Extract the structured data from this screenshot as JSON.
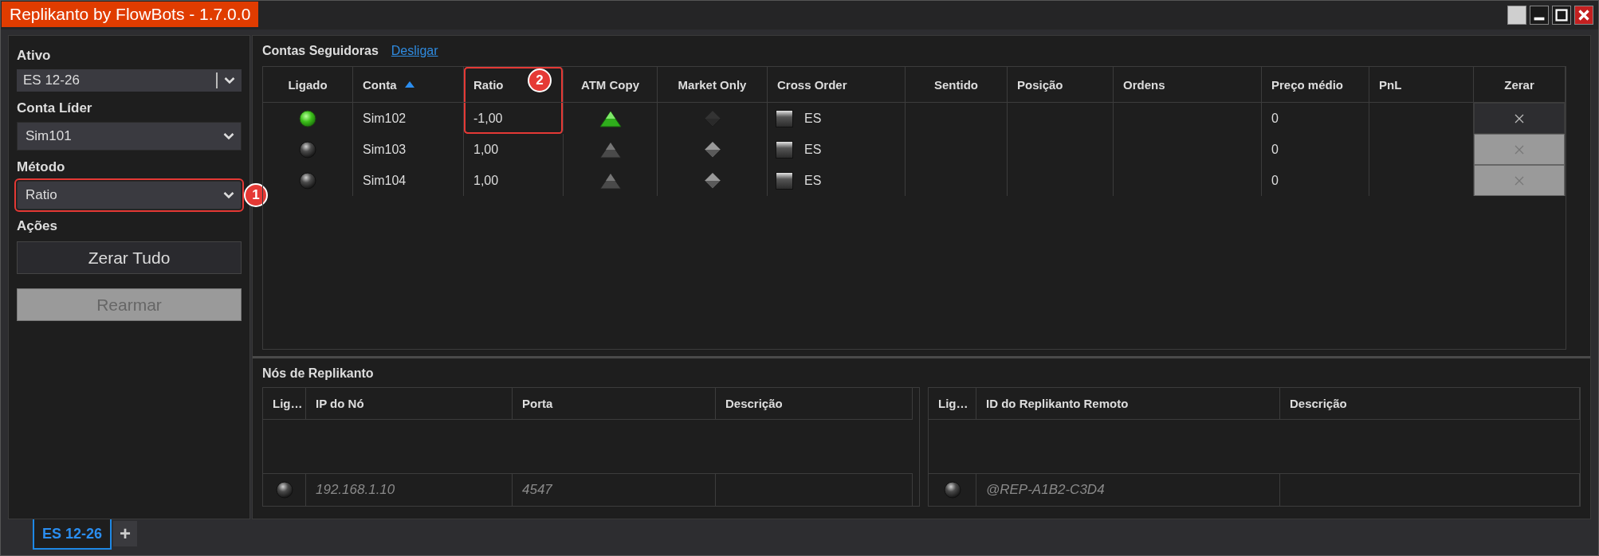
{
  "window": {
    "title": "Replikanto by FlowBots - 1.7.0.0"
  },
  "sidebar": {
    "fields": [
      {
        "label": "Ativo",
        "kind": "combo",
        "value": "ES 12-26"
      },
      {
        "label": "Conta Líder",
        "kind": "dropdown",
        "value": "Sim101"
      },
      {
        "label": "Método",
        "kind": "dropdown",
        "value": "Ratio",
        "callout": "1"
      }
    ],
    "actions_label": "Ações",
    "buttons": [
      {
        "label": "Zerar Tudo",
        "disabled": false
      },
      {
        "label": "Rearmar",
        "disabled": true
      }
    ]
  },
  "followers": {
    "title": "Contas Seguidoras",
    "link": "Desligar",
    "columns": [
      {
        "label": "Ligado",
        "sorted": false
      },
      {
        "label": "Conta",
        "sorted": true
      },
      {
        "label": "Ratio",
        "sorted": false,
        "callout": "2"
      },
      {
        "label": "ATM Copy",
        "sorted": false
      },
      {
        "label": "Market Only",
        "sorted": false
      },
      {
        "label": "Cross Order",
        "sorted": false
      },
      {
        "label": "Sentido",
        "sorted": false
      },
      {
        "label": "Posição",
        "sorted": false
      },
      {
        "label": "Ordens",
        "sorted": false
      },
      {
        "label": "Preço médio",
        "sorted": false
      },
      {
        "label": "PnL",
        "sorted": false
      },
      {
        "label": "Zerar",
        "sorted": false
      }
    ],
    "rows": [
      {
        "on": true,
        "account": "Sim102",
        "ratio": "-1,00",
        "atm_copy": true,
        "market_only_disabled": true,
        "cross_order": "ES",
        "avg_price": "0",
        "clear_disabled": false
      },
      {
        "on": false,
        "account": "Sim103",
        "ratio": "1,00",
        "atm_copy": false,
        "market_only_disabled": false,
        "cross_order": "ES",
        "avg_price": "0",
        "clear_disabled": true
      },
      {
        "on": false,
        "account": "Sim104",
        "ratio": "1,00",
        "atm_copy": false,
        "market_only_disabled": false,
        "cross_order": "ES",
        "avg_price": "0",
        "clear_disabled": true
      }
    ]
  },
  "nodes": {
    "title": "Nós de Replikanto",
    "local": {
      "columns": [
        "Lig…",
        "IP do Nó",
        "Porta",
        "Descrição"
      ],
      "rows": [
        {
          "on": false,
          "cells": [
            "",
            "192.168.1.10",
            "4547"
          ]
        }
      ]
    },
    "remote": {
      "columns": [
        "Lig…",
        "ID do Replikanto Remoto",
        "Descrição"
      ],
      "rows": [
        {
          "on": false,
          "cells": [
            "",
            "@REP-A1B2-C3D4"
          ]
        }
      ]
    }
  },
  "tabs": [
    {
      "label": "ES 12-26",
      "selected": true
    }
  ],
  "add_tab": "+"
}
